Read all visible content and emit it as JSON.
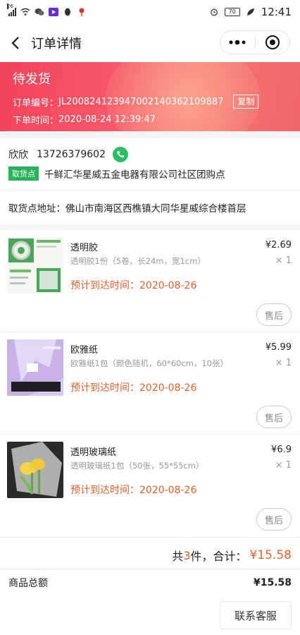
{
  "statusbar": {
    "network": "26",
    "battery": "70",
    "time": "12:41"
  },
  "navbar": {
    "title": "订单详情",
    "icons": [
      "back-arrow-icon",
      "more-dots-icon",
      "close-target-icon"
    ]
  },
  "banner": {
    "status": "待发货",
    "order_no_label": "订单编号：",
    "order_no": "JL20082412394700214036210988​7",
    "copy_label": "复制",
    "order_time_label": "下单时间：",
    "order_time": "2020-08-24 12:39:47"
  },
  "contact": {
    "name": "欣欣",
    "phone": "13726379602",
    "pickup_tag": "取货点",
    "pickup_name": "千鲜汇华星威五金电器有限公司社区团购点"
  },
  "address": {
    "label": "取货点地址：",
    "value": "佛山市南海区西樵镇大同华星威综合楼首层"
  },
  "items": [
    {
      "name": "透明胶",
      "spec": "透明胶1份（5卷，长24m，宽1cm）",
      "price": "¥2.69",
      "qty": "× 1",
      "eta": "预计到达时间：2020-08-26",
      "after_sale": "售后"
    },
    {
      "name": "欧雅纸",
      "spec": "欧雅纸1包（颜色随机，60*60cm，10张）",
      "price": "¥5.99",
      "qty": "× 1",
      "eta": "预计到达时间：2020-08-26",
      "after_sale": "售后"
    },
    {
      "name": "透明玻璃纸",
      "spec": "透明玻璃纸1包（50张，55*55cm）",
      "price": "¥6.9",
      "qty": "× 1",
      "eta": "预计到达时间：2020-08-26",
      "after_sale": "售后"
    }
  ],
  "summary": {
    "prefix": "共 ",
    "count": "3",
    "suffix": " 件，合计：",
    "total": "¥15.58"
  },
  "goods_total": {
    "label": "商品总额",
    "value": "¥15.58"
  },
  "service_button": "联系客服",
  "colors": {
    "accent": "#e2612d",
    "banner": "#f2435b",
    "tag_green": "#27b35a"
  }
}
